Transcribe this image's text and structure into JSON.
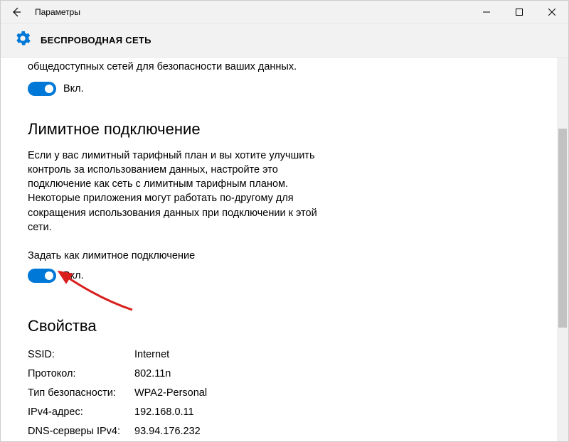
{
  "window": {
    "title": "Параметры"
  },
  "header": {
    "title": "БЕСПРОВОДНАЯ СЕТЬ"
  },
  "public_networks": {
    "partial_text": "общедоступных сетей для безопасности ваших данных.",
    "toggle_state": "Вкл."
  },
  "metered": {
    "heading": "Лимитное подключение",
    "description": "Если у вас лимитный тарифный план и вы хотите улучшить контроль за использованием данных, настройте это подключение как сеть с лимитным тарифным планом. Некоторые приложения могут работать по-другому для сокращения использования данных при подключении к этой сети.",
    "setting_label": "Задать как лимитное подключение",
    "toggle_state": "Вкл."
  },
  "properties": {
    "heading": "Свойства",
    "rows": [
      {
        "key": "SSID:",
        "val": "Internet"
      },
      {
        "key": "Протокол:",
        "val": "802.11n"
      },
      {
        "key": "Тип безопасности:",
        "val": "WPA2-Personal"
      },
      {
        "key": "IPv4-адрес:",
        "val": "192.168.0.11"
      },
      {
        "key": "DNS-серверы IPv4:",
        "val": "93.94.176.232"
      }
    ]
  }
}
